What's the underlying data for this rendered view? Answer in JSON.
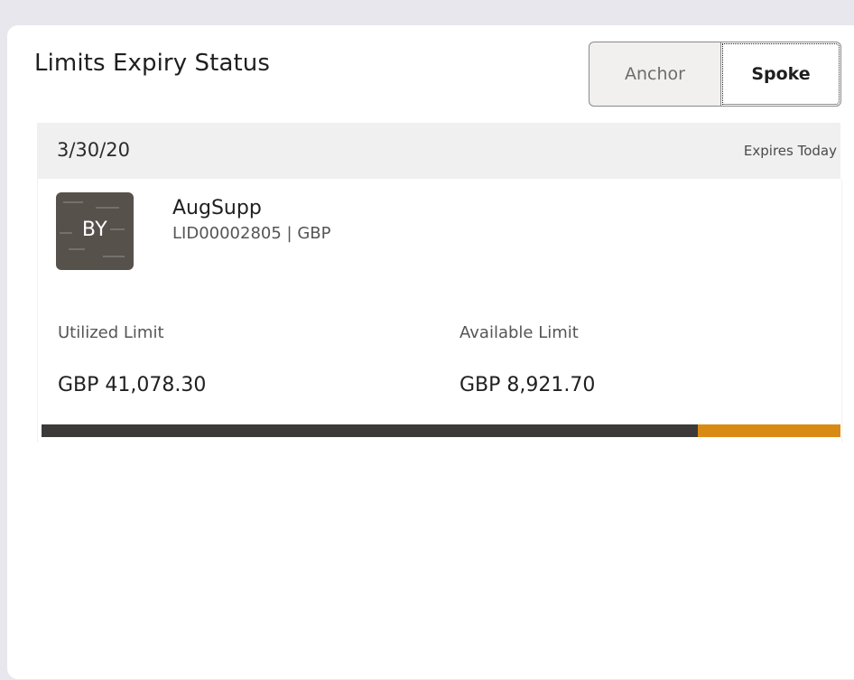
{
  "widget": {
    "title": "Limits Expiry Status",
    "toggle": {
      "anchor_label": "Anchor",
      "spoke_label": "Spoke",
      "selected": "Spoke"
    }
  },
  "expiry_group": {
    "date": "3/30/20",
    "status": "Expires Today"
  },
  "limit_entry": {
    "avatar_initials": "BY",
    "party_name": "AugSupp",
    "limit_id_currency": "LID00002805 | GBP",
    "utilized_label": "Utilized Limit",
    "utilized_value": "GBP 41,078.30",
    "available_label": "Available Limit",
    "available_value": "GBP 8,921.70",
    "utilization_fraction": 0.8216
  },
  "colors": {
    "utilized_bar": "#3c3a39",
    "available_bar": "#d98a14",
    "header_bg": "#f0f0f0"
  }
}
